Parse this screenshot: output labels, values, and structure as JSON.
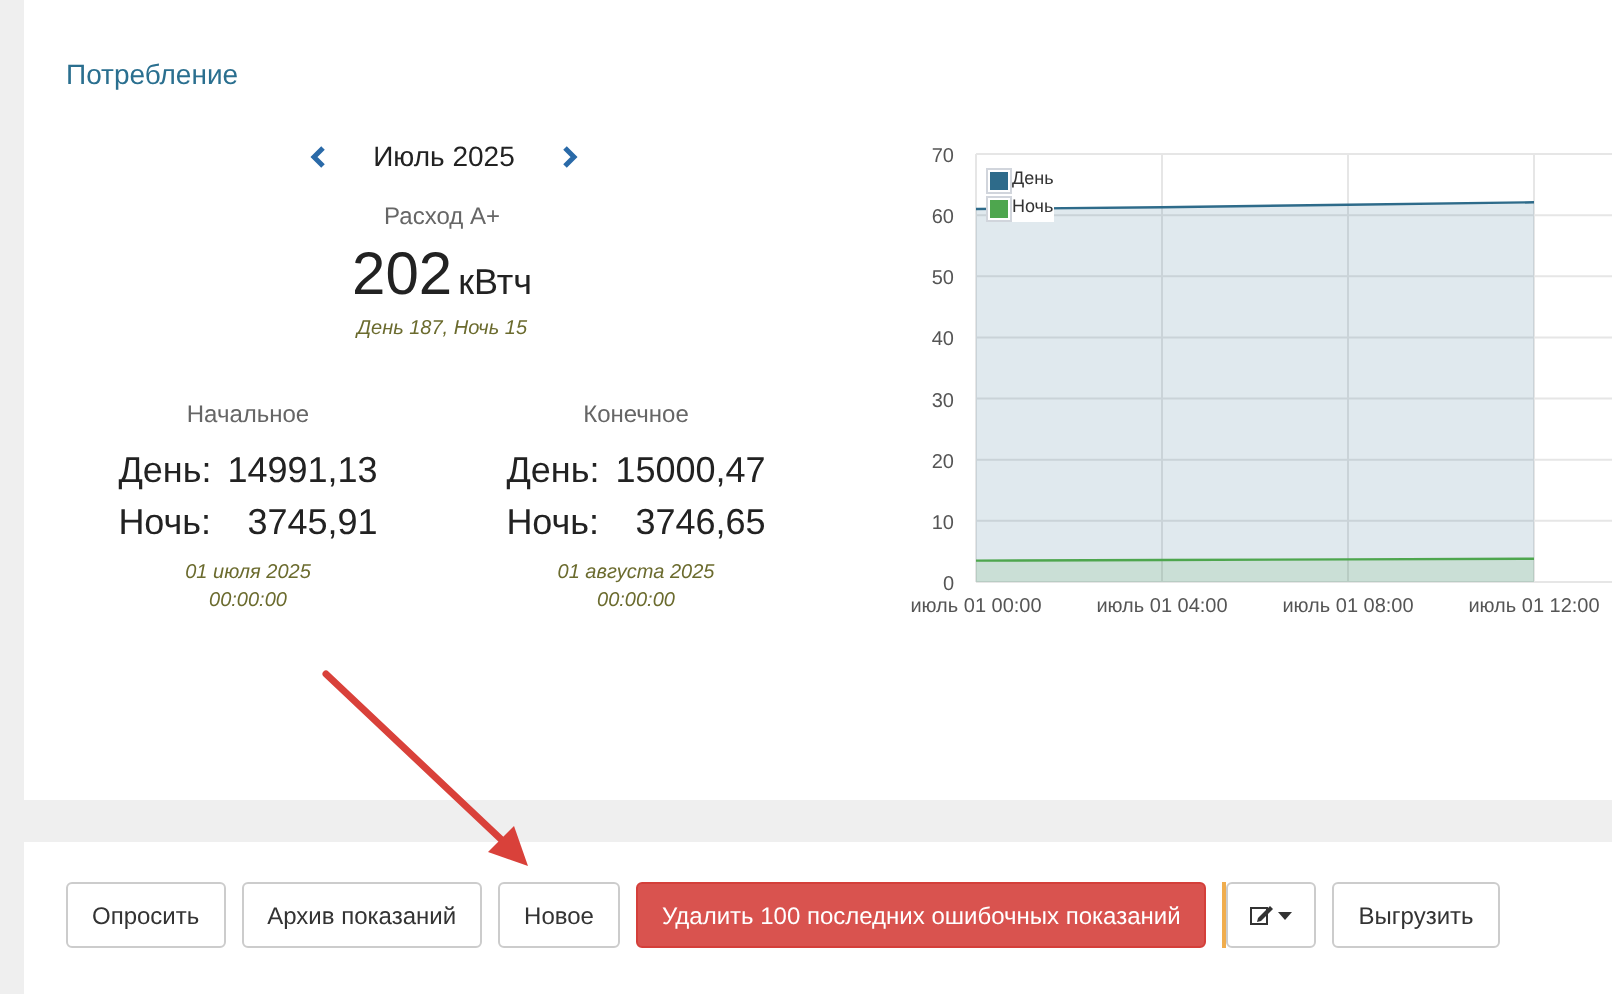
{
  "consumption": {
    "title": "Потребление",
    "month": "Июль 2025",
    "metric_label": "Расход A+",
    "total": "202",
    "unit": "кВтч",
    "breakdown": "День 187, Ночь 15",
    "readings": [
      {
        "heading": "Начальное",
        "day_label": "День:",
        "day_value": "14991,13",
        "night_label": "Ночь:",
        "night_value": "3745,91",
        "date": "01 июля 2025",
        "time": "00:00:00"
      },
      {
        "heading": "Конечное",
        "day_label": "День:",
        "day_value": "15000,47",
        "night_label": "Ночь:",
        "night_value": "3746,65",
        "date": "01 августа 2025",
        "time": "00:00:00"
      }
    ],
    "chart_data": {
      "type": "area",
      "categories": [
        "июль 01 00:00",
        "июль 01 04:00",
        "июль 01 08:00",
        "июль 01 12:00"
      ],
      "series": [
        {
          "name": "День",
          "color": "#2e6b8a",
          "values": [
            61,
            61.3,
            61.7,
            62.1
          ]
        },
        {
          "name": "Ночь",
          "color": "#4ea64e",
          "values": [
            3.5,
            3.6,
            3.7,
            3.8
          ]
        }
      ],
      "grid": true,
      "legend": "upper left",
      "ylim": [
        0,
        70
      ],
      "yticks": [
        0,
        10,
        20,
        30,
        40,
        50,
        60,
        70
      ]
    }
  },
  "buttons": [
    {
      "label": "Опросить",
      "kind": "default"
    },
    {
      "label": "Архив показаний",
      "kind": "default"
    },
    {
      "label": "Новое",
      "kind": "default"
    },
    {
      "label": "Удалить 100 последних ошибочных показаний",
      "kind": "danger"
    },
    {
      "kind": "edit-menu"
    },
    {
      "label": "Выгрузить",
      "kind": "default"
    }
  ]
}
